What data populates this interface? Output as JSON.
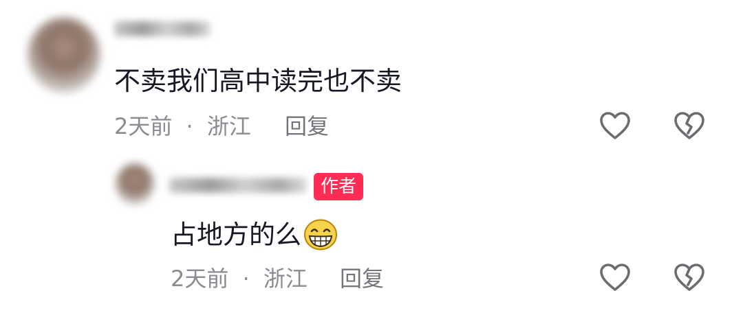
{
  "comment": {
    "text": "不卖我们高中读完也不卖",
    "time": "2天前",
    "separator": "·",
    "location": "浙江",
    "reply_label": "回复"
  },
  "reply": {
    "author_badge": "作者",
    "text": "占地方的么",
    "emoji": "grinning-face-emoji",
    "time": "2天前",
    "separator": "·",
    "location": "浙江",
    "reply_label": "回复"
  },
  "icons": {
    "like": "heart-icon",
    "dislike": "broken-heart-icon"
  },
  "colors": {
    "badge": "#fe2c55",
    "text": "#161823",
    "meta": "#8a8b91",
    "icon": "#6b6c70"
  }
}
